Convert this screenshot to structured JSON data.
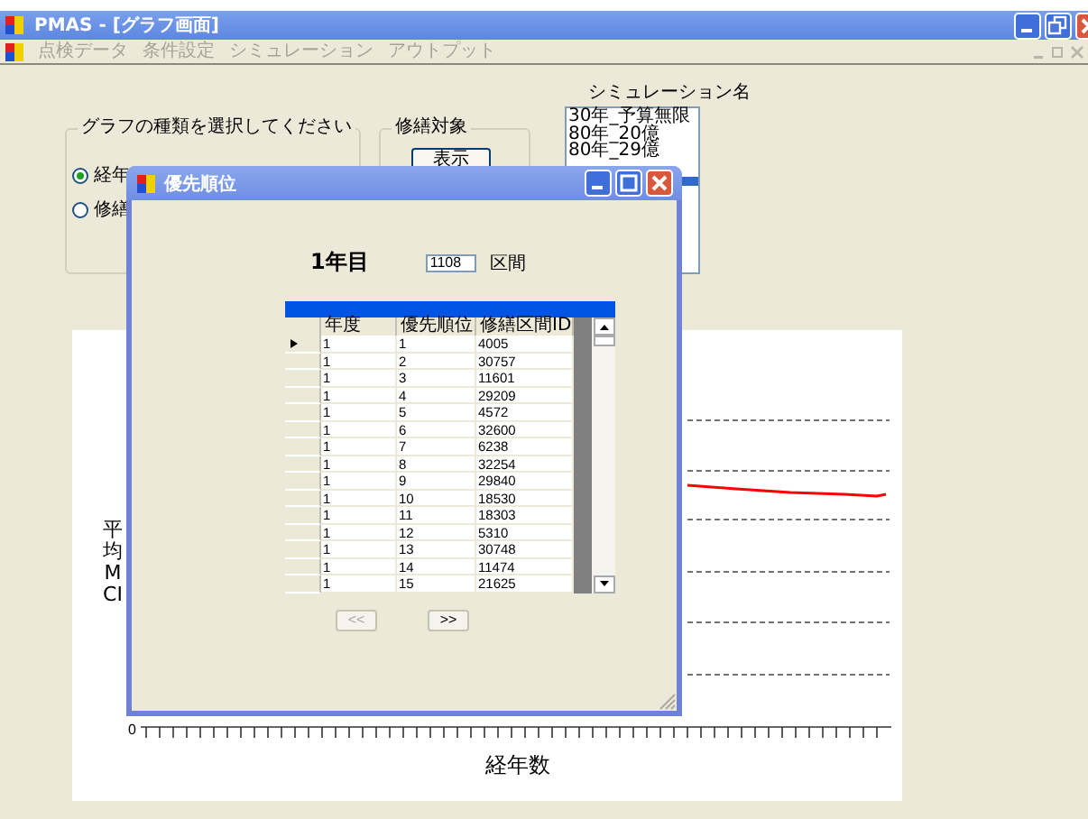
{
  "window": {
    "title": "PMAS - [グラフ画面]"
  },
  "menu": [
    {
      "label": "点検データ",
      "disabled": true
    },
    {
      "label": "条件設定",
      "disabled": true
    },
    {
      "label": "シミュレーション",
      "disabled": true
    },
    {
      "label": "アウトプット",
      "disabled": true
    }
  ],
  "graph_type_group": {
    "title": "グラフの種類を選択してください",
    "options": [
      {
        "label": "経年",
        "selected": true
      },
      {
        "label": "修繕",
        "selected": false
      }
    ]
  },
  "repair_target_group": {
    "title": "修繕対象",
    "button": "表示"
  },
  "simulation": {
    "label": "シミュレーション名",
    "items": [
      "30年_予算無限",
      "80年_20億",
      "80年_29億"
    ]
  },
  "chart": {
    "ylabel": "平均MCI",
    "xlabel": "経年数",
    "x_origin_label": "0"
  },
  "dialog": {
    "title": "優先順位",
    "year_label": "1年目",
    "section_value": "1108",
    "section_label": "区間",
    "grid": {
      "columns": [
        "年度",
        "優先順位",
        "修繕区間ID"
      ],
      "rows": [
        {
          "cells": [
            "1",
            "1",
            "4005"
          ],
          "current": true
        },
        {
          "cells": [
            "1",
            "2",
            "30757"
          ],
          "current": false
        },
        {
          "cells": [
            "1",
            "3",
            "11601"
          ],
          "current": false
        },
        {
          "cells": [
            "1",
            "4",
            "29209"
          ],
          "current": false
        },
        {
          "cells": [
            "1",
            "5",
            "4572"
          ],
          "current": false
        },
        {
          "cells": [
            "1",
            "6",
            "32600"
          ],
          "current": false
        },
        {
          "cells": [
            "1",
            "7",
            "6238"
          ],
          "current": false
        },
        {
          "cells": [
            "1",
            "8",
            "32254"
          ],
          "current": false
        },
        {
          "cells": [
            "1",
            "9",
            "29840"
          ],
          "current": false
        },
        {
          "cells": [
            "1",
            "10",
            "18530"
          ],
          "current": false
        },
        {
          "cells": [
            "1",
            "11",
            "18303"
          ],
          "current": false
        },
        {
          "cells": [
            "1",
            "12",
            "5310"
          ],
          "current": false
        },
        {
          "cells": [
            "1",
            "13",
            "30748"
          ],
          "current": false
        },
        {
          "cells": [
            "1",
            "14",
            "11474"
          ],
          "current": false
        },
        {
          "cells": [
            "1",
            "15",
            "21625"
          ],
          "current": false
        }
      ]
    },
    "buttons": [
      {
        "label": "<<",
        "disabled": true
      },
      {
        "label": ">>",
        "disabled": false
      }
    ]
  }
}
